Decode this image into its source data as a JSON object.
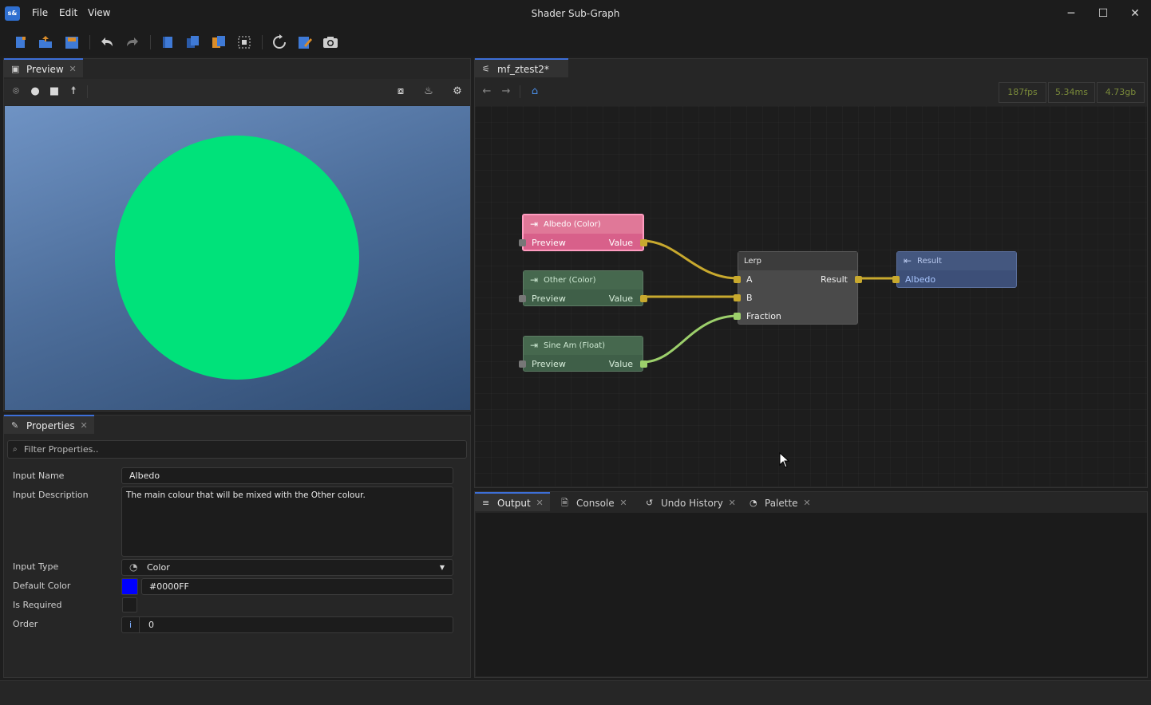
{
  "window": {
    "title": "Shader Sub-Graph",
    "app_icon_text": "s&",
    "menu": [
      "File",
      "Edit",
      "View"
    ],
    "controls": {
      "minimize": "─",
      "maximize": "☐",
      "close": "✕"
    }
  },
  "toolbar": {
    "buttons": [
      "new-file",
      "open-folder",
      "save",
      "undo",
      "redo",
      "page",
      "copy",
      "paste",
      "select-all",
      "refresh",
      "edit",
      "camera"
    ]
  },
  "preview": {
    "tab_label": "Preview",
    "sphere_color": "#00e27a"
  },
  "properties": {
    "tab_label": "Properties",
    "filter_placeholder": "Filter Properties..",
    "fields": {
      "input_name_label": "Input Name",
      "input_name_value": "Albedo",
      "input_description_label": "Input Description",
      "input_description_value": "The main colour that will be mixed with the Other colour.",
      "input_type_label": "Input Type",
      "input_type_value": "Color",
      "default_color_label": "Default Color",
      "default_color_value": "#0000FF",
      "is_required_label": "Is Required",
      "order_label": "Order",
      "order_prefix": "i",
      "order_value": "0"
    }
  },
  "graph": {
    "tab_label": "mf_ztest2*",
    "stats": {
      "fps": "187fps",
      "ms": "5.34ms",
      "mem": "4.73gb"
    },
    "nodes": {
      "albedo": {
        "title": "Albedo (Color)",
        "row_left": "Preview",
        "row_right": "Value"
      },
      "other": {
        "title": "Other (Color)",
        "row_left": "Preview",
        "row_right": "Value"
      },
      "sine": {
        "title": "Sine Am (Float)",
        "row_left": "Preview",
        "row_right": "Value"
      },
      "lerp": {
        "title": "Lerp",
        "in_a": "A",
        "in_b": "B",
        "in_fraction": "Fraction",
        "out": "Result"
      },
      "result": {
        "title": "Result",
        "in_albedo": "Albedo"
      }
    }
  },
  "bottom_tabs": {
    "output": "Output",
    "console": "Console",
    "undo_history": "Undo History",
    "palette": "Palette"
  },
  "colors": {
    "accent": "#3d6fd8",
    "wire_color": "#c8a92e",
    "wire_float": "#9ccf6b",
    "node_pink": "#d8608a",
    "node_green": "#3f5f48",
    "node_gray": "#4a4a4a",
    "node_blue": "#3d4f78"
  }
}
